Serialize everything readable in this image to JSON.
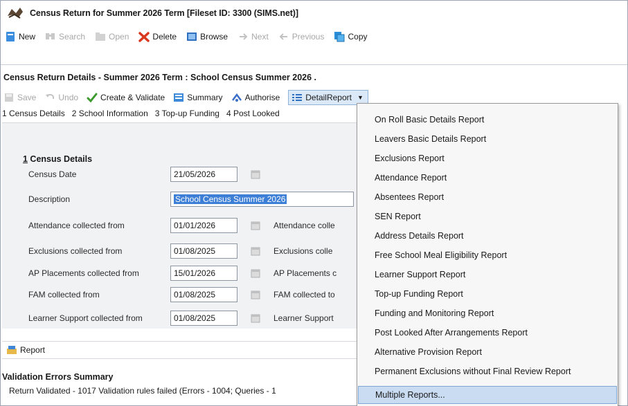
{
  "window": {
    "title": "Census Return for Summer 2026 Term [Fileset ID: 3300 (SIMS.net)]"
  },
  "toolbar": {
    "new": "New",
    "search": "Search",
    "open": "Open",
    "delete": "Delete",
    "browse": "Browse",
    "next": "Next",
    "previous": "Previous",
    "copy": "Copy"
  },
  "detail": {
    "title": "Census Return Details - Summer 2026 Term : School Census Summer 2026 .",
    "toolbar": {
      "save": "Save",
      "undo": "Undo",
      "create_validate": "Create & Validate",
      "summary": "Summary",
      "authorise": "Authorise",
      "detail_report": "DetailReport"
    },
    "tabs": [
      "1 Census Details",
      "2 School Information",
      "3 Top-up Funding",
      "4 Post Looked"
    ]
  },
  "census_details": {
    "section_number": "1",
    "section_title": " Census Details",
    "census_date_label": "Census Date",
    "census_date": "21/05/2026",
    "description_label": "Description",
    "description": "School Census Summer 2026",
    "rows": [
      {
        "label": "Attendance collected from",
        "value": "01/01/2026",
        "right_label": "Attendance colle"
      },
      {
        "label": "Exclusions collected from",
        "value": "01/08/2025",
        "right_label": "Exclusions colle"
      },
      {
        "label": "AP Placements collected from",
        "value": "15/01/2026",
        "right_label": "AP Placements c"
      },
      {
        "label": "FAM collected from",
        "value": "01/08/2025",
        "right_label": "FAM collected to"
      },
      {
        "label": "Learner Support collected from",
        "value": "01/08/2025",
        "right_label": "Learner Support"
      }
    ]
  },
  "report_bar": {
    "label": "Report"
  },
  "validation": {
    "title": "Validation Errors Summary",
    "text": "Return Validated - 1017 Validation rules failed (Errors - 1004; Queries - 1"
  },
  "detail_report_menu": {
    "items": [
      "On Roll Basic Details Report",
      "Leavers Basic Details Report",
      "Exclusions Report",
      "Attendance Report",
      "Absentees Report",
      "SEN Report",
      "Address Details Report",
      "Free School Meal Eligibility Report",
      "Learner Support Report",
      "Top-up Funding Report",
      "Funding and Monitoring Report",
      "Post Looked After Arrangements Report",
      "Alternative Provision Report",
      "Permanent Exclusions without Final Review Report",
      "Multiple Reports..."
    ],
    "highlighted_item": "Multiple Reports..."
  },
  "colors": {
    "menu_highlight": "#c9dcf2",
    "selection": "#3d7fd6",
    "delete_red": "#d9381e",
    "create_green": "#3c9a2e"
  },
  "icons": [
    "app-icon",
    "new-icon",
    "search-icon",
    "open-icon",
    "delete-icon",
    "browse-icon",
    "next-icon",
    "previous-icon",
    "copy-icon",
    "save-icon",
    "undo-icon",
    "create-validate-icon",
    "summary-icon",
    "authorise-icon",
    "detail-report-icon",
    "calendar-icon",
    "report-icon"
  ]
}
